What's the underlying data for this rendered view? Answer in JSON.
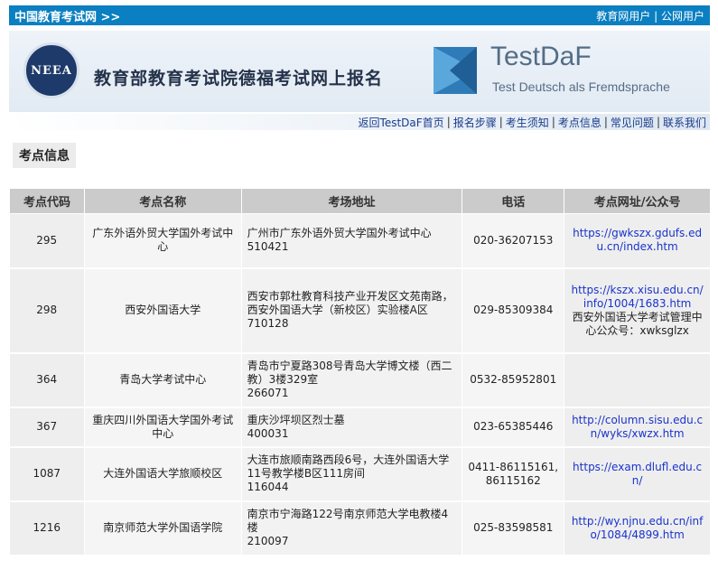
{
  "topbar": {
    "brand": "中国教育考试网 >>",
    "user_link_1": "教育网用户",
    "separator": "|",
    "user_link_2": "公网用户"
  },
  "banner": {
    "logo_text": "NEEA",
    "title": "教育部教育考试院德福考试网上报名",
    "testdaf_name": "TestDaF",
    "testdaf_sub": "Test Deutsch als Fremdsprache"
  },
  "nav": {
    "items": [
      "返回TestDaF首页",
      "报名步骤",
      "考生须知",
      "考点信息",
      "常见问题",
      "联系我们"
    ],
    "separator": "|"
  },
  "section_title": "考点信息",
  "table": {
    "headers": [
      "考点代码",
      "考点名称",
      "考场地址",
      "电话",
      "考点网址/公众号"
    ],
    "rows": [
      {
        "code": "295",
        "name": "广东外语外贸大学国外考试中心",
        "address": "广州市广东外语外贸大学国外考试中心",
        "postcode": "510421",
        "phone": "020-36207153",
        "url": "https://gwkszx.gdufs.edu.cn/index.htm",
        "note": ""
      },
      {
        "code": "298",
        "name": "西安外国语大学",
        "address": "西安市郭杜教育科技产业开发区文苑南路，西安外国语大学（新校区）实验楼A区",
        "postcode": "710128",
        "phone": "029-85309384",
        "url": "https://kszx.xisu.edu.cn/info/1004/1683.htm",
        "note": "西安外国语大学考试管理中心公众号：xwksglzx"
      },
      {
        "code": "364",
        "name": "青岛大学考试中心",
        "address": "青岛市宁夏路308号青岛大学博文楼（西二教）3楼329室",
        "postcode": "266071",
        "phone": "0532-85952801",
        "url": "",
        "note": ""
      },
      {
        "code": "367",
        "name": "重庆四川外国语大学国外考试中心",
        "address": "重庆沙坪坝区烈士墓",
        "postcode": "400031",
        "phone": "023-65385446",
        "url": "http://column.sisu.edu.cn/wyks/xwzx.htm",
        "note": ""
      },
      {
        "code": "1087",
        "name": "大连外国语大学旅顺校区",
        "address": "大连市旅顺南路西段6号，大连外国语大学11号教学楼B区111房间",
        "postcode": "116044",
        "phone": "0411-86115161,86115162",
        "url": "https://exam.dlufl.edu.cn/",
        "note": ""
      },
      {
        "code": "1216",
        "name": "南京师范大学外国语学院",
        "address": "南京市宁海路122号南京师范大学电教楼4楼",
        "postcode": "210097",
        "phone": "025-83598581",
        "url": "http://wy.njnu.edu.cn/info/1084/4899.htm",
        "note": ""
      }
    ]
  }
}
